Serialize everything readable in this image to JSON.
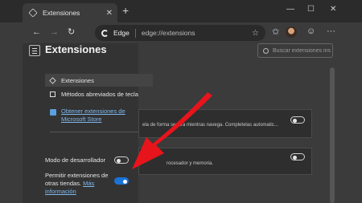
{
  "tab": {
    "title": "Extensiones"
  },
  "address": {
    "brand": "Edge",
    "url": "edge://extensions"
  },
  "page": {
    "title": "Extensiones",
    "search_placeholder": "Buscar extensiones ins..."
  },
  "sidebar": {
    "items": [
      {
        "label": "Extensiones",
        "active": true
      },
      {
        "label": "Métodos abreviados de tecla"
      }
    ],
    "store_link": [
      "Obtener extensiones de",
      "Microsoft Store"
    ]
  },
  "settings": {
    "developer_mode": {
      "label": "Modo de desarrollador",
      "on": false
    },
    "other_stores": {
      "label_lines": [
        "Permitir extensiones de",
        "otras tiendas."
      ],
      "more": "Más",
      "more_line2": "información",
      "on": true
    }
  },
  "cards": [
    {
      "desc": "ela de forma segura mientras navega. Completelas automatic...",
      "toggle_on": false
    },
    {
      "desc": "rocesador y memoria.",
      "toggle_on": false
    }
  ],
  "colors": {
    "accent": "#1a73d6",
    "annotation_arrow": "#e8141b"
  }
}
